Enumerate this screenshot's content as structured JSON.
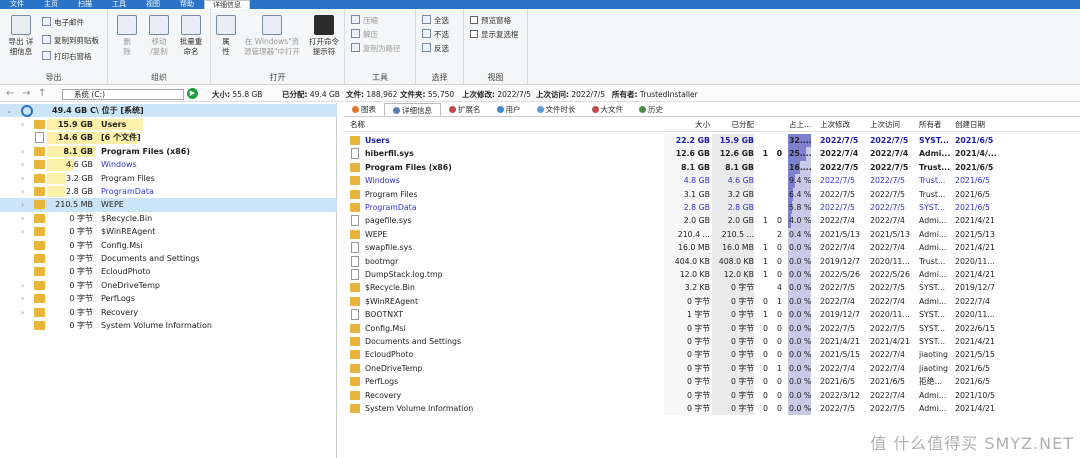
{
  "tabs": [
    "文件",
    "主页",
    "扫描",
    "工具",
    "视图",
    "帮助",
    "详细信息"
  ],
  "ribbon": {
    "export": {
      "big": "导出 详\n细信息",
      "m1": "电子邮件",
      "m2": "复制到剪贴板",
      "m3": "打印右窗格",
      "label": "导出"
    },
    "organize": {
      "delete": "删\n除",
      "move": "移动\n/复制",
      "rename": "批量重\n命名",
      "label": "组织"
    },
    "open": {
      "props": "属\n性",
      "explorer": "在 Windows\"资\n源管理器\"中打开",
      "cmd": "打开命令\n提示符",
      "label": "打开"
    },
    "tools": {
      "t1": "压缩",
      "t2": "解压",
      "t3": "复制为路径",
      "label": "工具"
    },
    "select": {
      "s1": "全选",
      "s2": "不选",
      "s3": "反选",
      "label": "选择"
    },
    "view": {
      "v1": "预览窗格",
      "v2": "显示复选框",
      "label": "视图"
    }
  },
  "address": {
    "drive": "系统 (C:)",
    "size_l": "大小:",
    "size_v": "55.8 GB",
    "used_l": "已分配:",
    "used_v": "49.4 GB",
    "files_l": "文件:",
    "files_v": "188,962",
    "folders_l": "文件夹:",
    "folders_v": "55,750",
    "mod_l": "上次修改:",
    "mod_v": "2022/7/5",
    "acc_l": "上次访问:",
    "acc_v": "2022/7/5",
    "owner_l": "所有者:",
    "owner_v": "TrustedInstaller"
  },
  "tree": {
    "root": {
      "size": "49.4 GB",
      "name": "C\\  位于  [系统]"
    },
    "items": [
      {
        "size": "15.9 GB",
        "name": "Users",
        "bold": true,
        "bar": 0.32,
        "icon": "folder",
        "chev": true
      },
      {
        "size": "14.6 GB",
        "name": "[6 个文件]",
        "bold": true,
        "bar": 0.3,
        "icon": "file",
        "chev": false
      },
      {
        "size": "8.1 GB",
        "name": "Program Files (x86)",
        "bold": true,
        "bar": 0.16,
        "icon": "folder",
        "chev": true
      },
      {
        "size": "4.6 GB",
        "name": "Windows",
        "bold": false,
        "bar": 0.09,
        "icon": "folder",
        "chev": true,
        "color": "#3333cc"
      },
      {
        "size": "3.2 GB",
        "name": "Program Files",
        "bold": false,
        "bar": 0.06,
        "icon": "folder",
        "chev": true
      },
      {
        "size": "2.8 GB",
        "name": "ProgramData",
        "bold": false,
        "bar": 0.06,
        "icon": "folder",
        "chev": true,
        "color": "#3333cc"
      },
      {
        "size": "210.5 MB",
        "name": "WEPE",
        "bold": false,
        "bar": 0,
        "icon": "folder",
        "chev": true,
        "sel": true
      },
      {
        "size": "0 字节",
        "name": "$Recycle.Bin",
        "bold": false,
        "bar": 0,
        "icon": "folder",
        "chev": true
      },
      {
        "size": "0 字节",
        "name": "$WinREAgent",
        "bold": false,
        "bar": 0,
        "icon": "folder",
        "chev": true
      },
      {
        "size": "0 字节",
        "name": "Config.Msi",
        "bold": false,
        "bar": 0,
        "icon": "folder",
        "chev": false
      },
      {
        "size": "0 字节",
        "name": "Documents and Settings",
        "bold": false,
        "bar": 0,
        "icon": "folder",
        "chev": false
      },
      {
        "size": "0 字节",
        "name": "EcloudPhoto",
        "bold": false,
        "bar": 0,
        "icon": "folder",
        "chev": false
      },
      {
        "size": "0 字节",
        "name": "OneDriveTemp",
        "bold": false,
        "bar": 0,
        "icon": "folder",
        "chev": true
      },
      {
        "size": "0 字节",
        "name": "PerfLogs",
        "bold": false,
        "bar": 0,
        "icon": "folder",
        "chev": true
      },
      {
        "size": "0 字节",
        "name": "Recovery",
        "bold": false,
        "bar": 0,
        "icon": "folder",
        "chev": true
      },
      {
        "size": "0 字节",
        "name": "System Volume Information",
        "bold": false,
        "bar": 0,
        "icon": "folder",
        "chev": false
      }
    ]
  },
  "viewtabs": [
    "图表",
    "详细信息",
    "扩展名",
    "用户",
    "文件时长",
    "大文件",
    "历史"
  ],
  "headers": {
    "name": "名称",
    "size": "大小",
    "alloc": "已分配",
    "pct": "占上...",
    "mod": "上次修改",
    "acc": "上次访问",
    "owner": "所有者",
    "created": "创建日期"
  },
  "rows": [
    {
      "name": "Users",
      "size": "22.2 GB",
      "alloc": "15.9 GB",
      "c1": "",
      "c2": "",
      "pct": "32....",
      "p": 0.32,
      "mod": "2022/7/5",
      "acc": "2022/7/5",
      "owner": "SYST...",
      "created": "2021/6/5",
      "bold": true,
      "icon": "folder",
      "color": "#1a1aa8"
    },
    {
      "name": "hiberfil.sys",
      "size": "12.6 GB",
      "alloc": "12.6 GB",
      "c1": "1",
      "c2": "0",
      "pct": "25....",
      "p": 0.25,
      "mod": "2022/7/4",
      "acc": "2022/7/4",
      "owner": "Admi...",
      "created": "2021/4/...",
      "bold": true,
      "icon": "file",
      "color": "#222"
    },
    {
      "name": "Program Files (x86)",
      "size": "8.1 GB",
      "alloc": "8.1 GB",
      "c1": "",
      "c2": "",
      "pct": "16....",
      "p": 0.16,
      "mod": "2022/7/5",
      "acc": "2022/7/5",
      "owner": "Trust...",
      "created": "2021/6/5",
      "bold": true,
      "icon": "folder",
      "color": "#222"
    },
    {
      "name": "Windows",
      "size": "4.8 GB",
      "alloc": "4.6 GB",
      "c1": "",
      "c2": "",
      "pct": "9.4 %",
      "p": 0.094,
      "mod": "2022/7/5",
      "acc": "2022/7/5",
      "owner": "Trust...",
      "created": "2021/6/5",
      "bold": false,
      "icon": "folder",
      "color": "#3333cc"
    },
    {
      "name": "Program Files",
      "size": "3.1 GB",
      "alloc": "3.2 GB",
      "c1": "",
      "c2": "",
      "pct": "6.4 %",
      "p": 0.064,
      "mod": "2022/7/5",
      "acc": "2022/7/5",
      "owner": "Trust...",
      "created": "2021/6/5",
      "bold": false,
      "icon": "folder",
      "color": "#222"
    },
    {
      "name": "ProgramData",
      "size": "2.8 GB",
      "alloc": "2.8 GB",
      "c1": "",
      "c2": "",
      "pct": "5.8 %",
      "p": 0.058,
      "mod": "2022/7/5",
      "acc": "2022/7/5",
      "owner": "SYST...",
      "created": "2021/6/5",
      "bold": false,
      "icon": "folder",
      "color": "#3333cc"
    },
    {
      "name": "pagefile.sys",
      "size": "2.0 GB",
      "alloc": "2.0 GB",
      "c1": "1",
      "c2": "0",
      "pct": "4.0 %",
      "p": 0.04,
      "mod": "2022/7/4",
      "acc": "2022/7/4",
      "owner": "Admi...",
      "created": "2021/4/21",
      "bold": false,
      "icon": "file",
      "color": "#222"
    },
    {
      "name": "WEPE",
      "size": "210.4 ...",
      "alloc": "210.5 ...",
      "c1": "",
      "c2": "2",
      "pct": "0.4 %",
      "p": 0.004,
      "mod": "2021/5/13",
      "acc": "2021/5/13",
      "owner": "Admi...",
      "created": "2021/5/13",
      "bold": false,
      "icon": "folder",
      "color": "#222"
    },
    {
      "name": "swapfile.sys",
      "size": "16.0 MB",
      "alloc": "16.0 MB",
      "c1": "1",
      "c2": "0",
      "pct": "0.0 %",
      "p": 0,
      "mod": "2022/7/4",
      "acc": "2022/7/4",
      "owner": "Admi...",
      "created": "2021/4/21",
      "bold": false,
      "icon": "file",
      "color": "#222"
    },
    {
      "name": "bootmgr",
      "size": "404.0 KB",
      "alloc": "408.0 KB",
      "c1": "1",
      "c2": "0",
      "pct": "0.0 %",
      "p": 0,
      "mod": "2019/12/7",
      "acc": "2020/11...",
      "owner": "Trust...",
      "created": "2020/11...",
      "bold": false,
      "icon": "file",
      "color": "#222"
    },
    {
      "name": "DumpStack.log.tmp",
      "size": "12.0 KB",
      "alloc": "12.0 KB",
      "c1": "1",
      "c2": "0",
      "pct": "0.0 %",
      "p": 0,
      "mod": "2022/5/26",
      "acc": "2022/5/26",
      "owner": "Admi...",
      "created": "2021/4/21",
      "bold": false,
      "icon": "file",
      "color": "#222"
    },
    {
      "name": "$Recycle.Bin",
      "size": "3.2 KB",
      "alloc": "0 字节",
      "c1": "",
      "c2": "4",
      "pct": "0.0 %",
      "p": 0,
      "mod": "2022/7/5",
      "acc": "2022/7/5",
      "owner": "SYST...",
      "created": "2019/12/7",
      "bold": false,
      "icon": "folder",
      "color": "#222"
    },
    {
      "name": "$WinREAgent",
      "size": "0 字节",
      "alloc": "0 字节",
      "c1": "0",
      "c2": "1",
      "pct": "0.0 %",
      "p": 0,
      "mod": "2022/7/4",
      "acc": "2022/7/4",
      "owner": "Admi...",
      "created": "2022/7/4",
      "bold": false,
      "icon": "folder",
      "color": "#222"
    },
    {
      "name": "BOOTNXT",
      "size": "1 字节",
      "alloc": "0 字节",
      "c1": "1",
      "c2": "0",
      "pct": "0.0 %",
      "p": 0,
      "mod": "2019/12/7",
      "acc": "2020/11...",
      "owner": "SYST...",
      "created": "2020/11...",
      "bold": false,
      "icon": "file",
      "color": "#222"
    },
    {
      "name": "Config.Msi",
      "size": "0 字节",
      "alloc": "0 字节",
      "c1": "0",
      "c2": "0",
      "pct": "0.0 %",
      "p": 0,
      "mod": "2022/7/5",
      "acc": "2022/7/5",
      "owner": "SYST...",
      "created": "2022/6/15",
      "bold": false,
      "icon": "folder",
      "color": "#222"
    },
    {
      "name": "Documents and Settings",
      "size": "0 字节",
      "alloc": "0 字节",
      "c1": "0",
      "c2": "0",
      "pct": "0.0 %",
      "p": 0,
      "mod": "2021/4/21",
      "acc": "2021/4/21",
      "owner": "SYST...",
      "created": "2021/4/21",
      "bold": false,
      "icon": "folder",
      "color": "#222"
    },
    {
      "name": "EcloudPhoto",
      "size": "0 字节",
      "alloc": "0 字节",
      "c1": "0",
      "c2": "0",
      "pct": "0.0 %",
      "p": 0,
      "mod": "2021/5/15",
      "acc": "2022/7/4",
      "owner": "jiaoting",
      "created": "2021/5/15",
      "bold": false,
      "icon": "folder",
      "color": "#222"
    },
    {
      "name": "OneDriveTemp",
      "size": "0 字节",
      "alloc": "0 字节",
      "c1": "0",
      "c2": "1",
      "pct": "0.0 %",
      "p": 0,
      "mod": "2022/7/4",
      "acc": "2022/7/4",
      "owner": "jiaoting",
      "created": "2021/6/5",
      "bold": false,
      "icon": "folder",
      "color": "#222"
    },
    {
      "name": "PerfLogs",
      "size": "0 字节",
      "alloc": "0 字节",
      "c1": "0",
      "c2": "0",
      "pct": "0.0 %",
      "p": 0,
      "mod": "2021/6/5",
      "acc": "2021/6/5",
      "owner": "拒绝...",
      "created": "2021/6/5",
      "bold": false,
      "icon": "folder",
      "color": "#222"
    },
    {
      "name": "Recovery",
      "size": "0 字节",
      "alloc": "0 字节",
      "c1": "0",
      "c2": "0",
      "pct": "0.0 %",
      "p": 0,
      "mod": "2022/3/12",
      "acc": "2022/7/4",
      "owner": "Admi...",
      "created": "2021/10/5",
      "bold": false,
      "icon": "folder",
      "color": "#222"
    },
    {
      "name": "System Volume Information",
      "size": "0 字节",
      "alloc": "0 字节",
      "c1": "0",
      "c2": "0",
      "pct": "0.0 %",
      "p": 0,
      "mod": "2022/7/5",
      "acc": "2022/7/5",
      "owner": "Admi...",
      "created": "2021/4/21",
      "bold": false,
      "icon": "folder",
      "color": "#222"
    }
  ],
  "watermark": "值 什么值得买 SMYZ.NET"
}
